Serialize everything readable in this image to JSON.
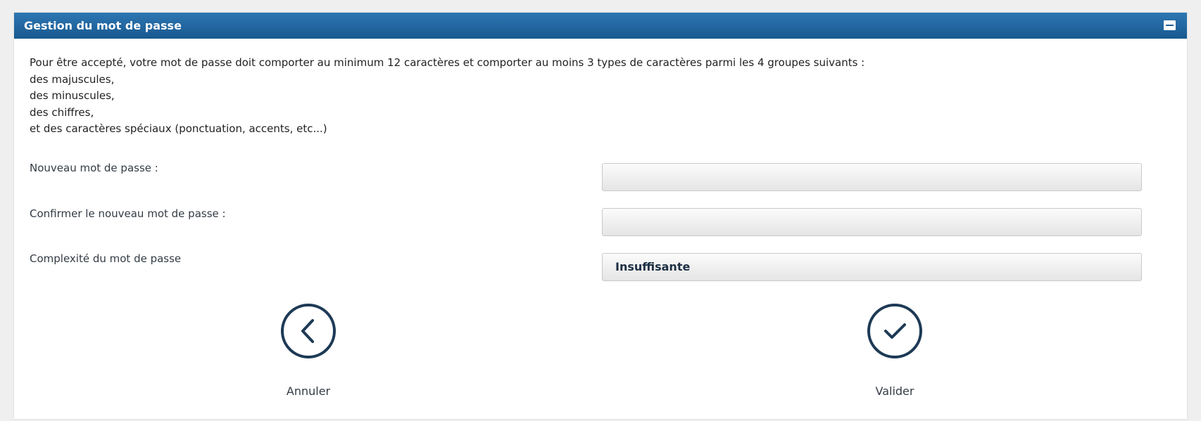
{
  "panel": {
    "title": "Gestion du mot de passe",
    "collapse_icon": "minus-box-icon"
  },
  "rules": {
    "intro": "Pour être accepté, votre mot de passe doit comporter au minimum 12 caractères et comporter au moins 3 types de caractères parmi les 4 groupes suivants :",
    "items": [
      "des majuscules,",
      "des minuscules,",
      "des chiffres,",
      "et des caractères spéciaux (ponctuation, accents, etc...)"
    ]
  },
  "form": {
    "new_password_label": "Nouveau mot de passe :",
    "new_password_value": "",
    "confirm_password_label": "Confirmer le nouveau mot de passe :",
    "confirm_password_value": "",
    "complexity_label": "Complexité du mot de passe",
    "complexity_value": "Insuffisante"
  },
  "actions": {
    "cancel_label": "Annuler",
    "cancel_icon": "chevron-left-circle-icon",
    "submit_label": "Valider",
    "submit_icon": "check-circle-icon"
  },
  "colors": {
    "header": "#1e66a2",
    "icon": "#1d3a55"
  }
}
